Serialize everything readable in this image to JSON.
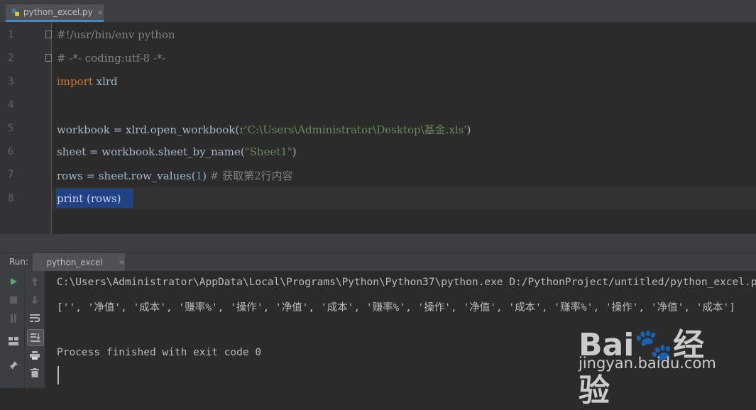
{
  "editor_tab": {
    "filename": "python_excel.py",
    "close": "×"
  },
  "code": {
    "line_numbers": [
      "1",
      "2",
      "3",
      "4",
      "5",
      "6",
      "7",
      "8"
    ],
    "l1": "#!/usr/bin/env python",
    "l2": "# -*- coding:utf-8 -*-",
    "l3_kw": "import",
    "l3_rest": " xlrd",
    "l5_a": "workbook = xlrd.open_workbook(",
    "l5_str": "r'C:\\Users\\Administrator\\Desktop\\基金.xls'",
    "l5_b": ")",
    "l6_a": "sheet = workbook.sheet_by_name(",
    "l6_str": "\"Sheet1\"",
    "l6_b": ")",
    "l7_a": "rows = sheet.row_values(",
    "l7_num": "1",
    "l7_b": ") ",
    "l7_cmt": "# 获取第2行内容",
    "l8": "print (rows)"
  },
  "run_panel": {
    "label": "Run:",
    "tab_name": "python_excel",
    "close": "×"
  },
  "console": {
    "line1": "C:\\Users\\Administrator\\AppData\\Local\\Programs\\Python\\Python37\\python.exe D:/PythonProject/untitled/python_excel.py",
    "line2": "['', '净值', '成本', '赚率%', '操作', '净值', '成本', '赚率%', '操作', '净值', '成本', '赚率%', '操作', '净值', '成本']",
    "line4": "Process finished with exit code 0"
  },
  "watermark": {
    "logo": "Bai🐾经验",
    "url": "jingyan.baidu.com"
  },
  "colors": {
    "background": "#2b2b2b",
    "keyword": "#cc7832",
    "string": "#6a8759",
    "comment": "#808080",
    "selection": "#214283"
  },
  "icons": [
    "python-file-icon",
    "run-icon",
    "stop-icon",
    "pause-icon",
    "up-arrow-icon",
    "down-arrow-icon",
    "soft-wrap-icon",
    "scroll-to-end-icon",
    "print-icon",
    "trash-icon",
    "layout-icon",
    "pin-icon"
  ]
}
